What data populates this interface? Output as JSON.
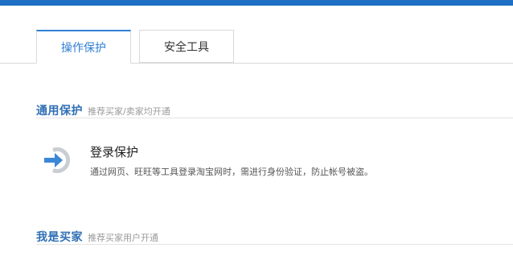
{
  "tabs": [
    {
      "label": "操作保护",
      "active": true
    },
    {
      "label": "安全工具",
      "active": false
    }
  ],
  "sections": {
    "general": {
      "title": "通用保护",
      "subtitle": "推荐买家/卖家均开通"
    },
    "buyer": {
      "title": "我是买家",
      "subtitle": "推荐买家用户开通"
    }
  },
  "features": [
    {
      "title": "登录保护",
      "description": "通过网页、旺旺等工具登录淘宝网时，需进行身份验证，防止帐号被盗。",
      "icon": "login-arrow-icon"
    }
  ],
  "colors": {
    "top_bar": "#1f6fc5",
    "accent": "#2f7fd4",
    "section_title": "#2f6fb5"
  }
}
